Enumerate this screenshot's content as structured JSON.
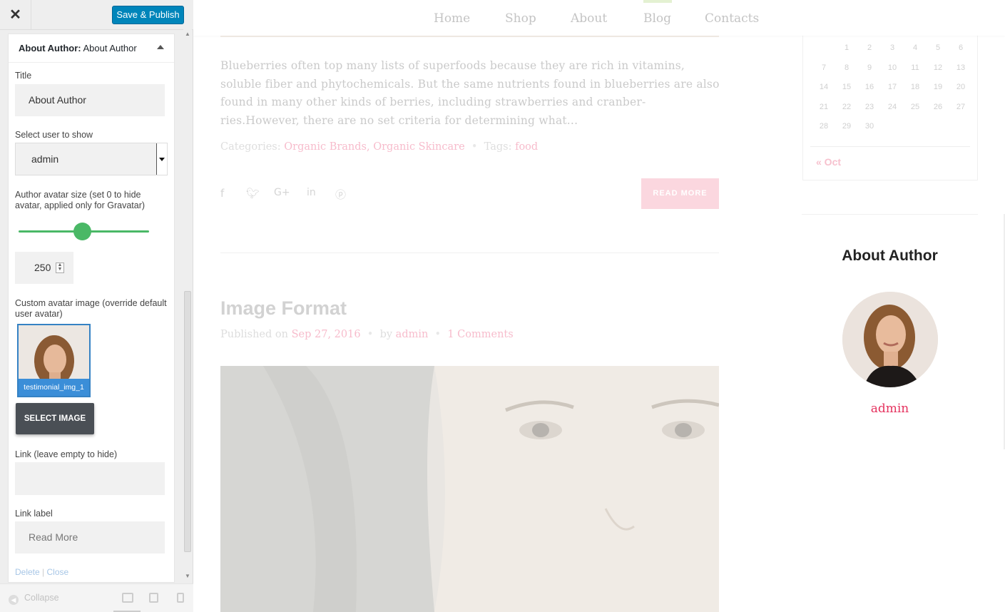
{
  "customizer": {
    "close_glyph": "✕",
    "save_label": "Save & Publish",
    "widget_header_prefix": "About Author:",
    "widget_header_title": "About Author",
    "title_label": "Title",
    "title_value": "About Author",
    "user_label": "Select user to show",
    "user_value": "admin",
    "avatar_size_label": "Author avatar size (set 0 to hide avatar, applied only for Gravatar)",
    "avatar_size_value": "250",
    "custom_avatar_label": "Custom avatar image (override default user avatar)",
    "image_caption": "testimonial_img_1",
    "select_image_label": "SELECT IMAGE",
    "link_label": "Link (leave empty to hide)",
    "link_value": "",
    "link_text_label": "Link label",
    "link_text_value": "Read More",
    "delete_label": "Delete",
    "close_label": "Close",
    "collapse_label": "Collapse"
  },
  "preview": {
    "nav": [
      "Home",
      "Shop",
      "About",
      "Blog",
      "Contacts"
    ],
    "excerpt": "Blueberries often top many lists of superfoods because they are rich in vitamins, soluble fiber and phytochemicals. But the same nutrients found in blueberries are also found in many other kinds of berries, including strawberries and cranber-ries.However, there are no set criteria for determining what...",
    "categories_label": "Categories:",
    "categories": [
      "Organic Brands",
      "Organic Skincare"
    ],
    "tags_label": "Tags:",
    "tag": "food",
    "read_more": "READ MORE",
    "post_title": "Image Format",
    "published_label": "Published on",
    "date": "Sep 27, 2016",
    "by_label": "by",
    "author": "admin",
    "comments": "1 Comments"
  },
  "sidebar": {
    "calendar_rows": [
      [
        "",
        "1",
        "2",
        "3",
        "4",
        "5",
        "6"
      ],
      [
        "7",
        "8",
        "9",
        "10",
        "11",
        "12",
        "13"
      ],
      [
        "14",
        "15",
        "16",
        "17",
        "18",
        "19",
        "20"
      ],
      [
        "21",
        "22",
        "23",
        "24",
        "25",
        "26",
        "27"
      ],
      [
        "28",
        "29",
        "30",
        "",
        "",
        "",
        ""
      ]
    ],
    "prev_month": "« Oct",
    "about_title": "About Author",
    "author_name": "admin"
  },
  "colors": {
    "save_button": "#0085ba",
    "slider": "#4ab866",
    "accent_pink": "#e5335f",
    "read_more_bg": "#fbd7df"
  },
  "icons": [
    "close-icon",
    "collapse-icon",
    "desktop-icon",
    "tablet-icon",
    "mobile-icon",
    "facebook-icon",
    "twitter-icon",
    "google-plus-icon",
    "linkedin-icon",
    "pinterest-icon"
  ],
  "avatar_slider_fraction": 0.5
}
